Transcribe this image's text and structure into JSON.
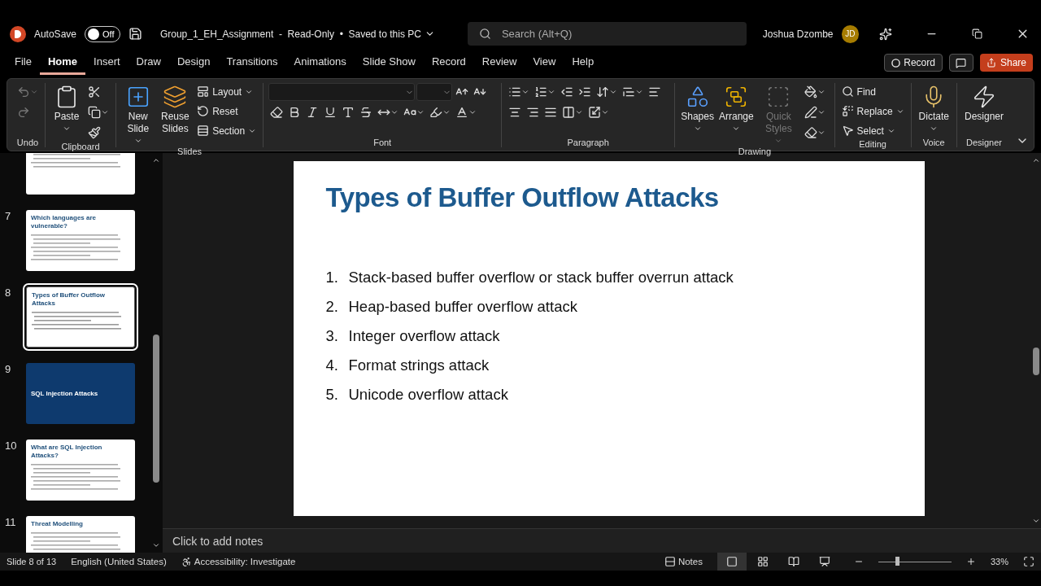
{
  "title_bar": {
    "autosave_label": "AutoSave",
    "autosave_on": false,
    "autosave_state": "Off",
    "document_title": "Group_1_EH_Assignment  -  Read-Only  •  Saved to this PC",
    "search_placeholder": "Search (Alt+Q)",
    "user_name": "Joshua Dzombe",
    "avatar_initials": "JD"
  },
  "menu_tabs": [
    {
      "label": "File",
      "selected": false
    },
    {
      "label": "Home",
      "selected": true
    },
    {
      "label": "Insert",
      "selected": false
    },
    {
      "label": "Draw",
      "selected": false
    },
    {
      "label": "Design",
      "selected": false
    },
    {
      "label": "Transitions",
      "selected": false
    },
    {
      "label": "Animations",
      "selected": false
    },
    {
      "label": "Slide Show",
      "selected": false
    },
    {
      "label": "Record",
      "selected": false
    },
    {
      "label": "Review",
      "selected": false
    },
    {
      "label": "View",
      "selected": false
    },
    {
      "label": "Help",
      "selected": false
    }
  ],
  "header_buttons": {
    "record": "Record",
    "share": "Share"
  },
  "ribbon_groups": [
    {
      "label": "Undo",
      "buttons": [
        {
          "kind": "icon",
          "disabled": true,
          "dropdown": true
        },
        {
          "kind": "icon",
          "disabled": true,
          "dropdown": false
        }
      ]
    },
    {
      "label": "Clipboard",
      "buttons": [
        {
          "kind": "large",
          "label": "Paste",
          "dropdown": true,
          "disabled": false
        },
        {
          "kind": "icon",
          "disabled": false,
          "dropdown": false
        },
        {
          "kind": "icon",
          "disabled": false,
          "dropdown": true
        },
        {
          "kind": "icon",
          "disabled": false,
          "dropdown": false
        }
      ]
    },
    {
      "label": "Slides",
      "buttons": [
        {
          "kind": "large",
          "label": "New Slide",
          "dropdown": true,
          "disabled": false
        },
        {
          "kind": "large",
          "label": "Reuse Slides",
          "dropdown": false,
          "disabled": false
        },
        {
          "kind": "small",
          "label": "Layout",
          "dropdown": true,
          "disabled": false
        },
        {
          "kind": "small",
          "label": "Reset",
          "dropdown": false,
          "disabled": false
        },
        {
          "kind": "small",
          "label": "Section",
          "dropdown": true,
          "disabled": false
        }
      ]
    },
    {
      "label": "Font",
      "buttons": [
        {
          "kind": "field"
        },
        {
          "kind": "field"
        },
        {
          "kind": "icon",
          "disabled": false,
          "dropdown": false
        },
        {
          "kind": "icon",
          "disabled": false,
          "dropdown": false
        },
        {
          "kind": "icon",
          "disabled": false,
          "dropdown": false
        },
        {
          "kind": "icon",
          "disabled": false,
          "dropdown": false
        },
        {
          "kind": "icon",
          "disabled": false,
          "dropdown": false
        },
        {
          "kind": "icon",
          "disabled": false,
          "dropdown": false
        },
        {
          "kind": "icon",
          "disabled": false,
          "dropdown": false
        },
        {
          "kind": "icon",
          "disabled": false,
          "dropdown": false
        },
        {
          "kind": "icon",
          "disabled": false,
          "dropdown": true
        },
        {
          "kind": "icon",
          "disabled": false,
          "dropdown": true
        },
        {
          "kind": "icon",
          "disabled": false,
          "dropdown": true
        },
        {
          "kind": "icon",
          "disabled": false,
          "dropdown": true
        }
      ]
    },
    {
      "label": "Paragraph",
      "buttons": [
        {
          "kind": "icon",
          "disabled": false,
          "dropdown": true
        },
        {
          "kind": "icon",
          "disabled": false,
          "dropdown": true
        },
        {
          "kind": "icon",
          "disabled": false,
          "dropdown": false
        },
        {
          "kind": "icon",
          "disabled": false,
          "dropdown": false
        },
        {
          "kind": "icon",
          "disabled": false,
          "dropdown": true
        },
        {
          "kind": "icon",
          "disabled": false,
          "dropdown": true
        },
        {
          "kind": "icon",
          "disabled": false,
          "dropdown": false
        },
        {
          "kind": "icon",
          "disabled": false,
          "dropdown": false
        },
        {
          "kind": "icon",
          "disabled": false,
          "dropdown": false
        },
        {
          "kind": "icon",
          "disabled": false,
          "dropdown": false
        },
        {
          "kind": "icon",
          "disabled": false,
          "dropdown": true
        },
        {
          "kind": "icon",
          "disabled": false,
          "dropdown": true
        }
      ]
    },
    {
      "label": "Drawing",
      "buttons": [
        {
          "kind": "large",
          "label": "Shapes",
          "dropdown": true,
          "disabled": false
        },
        {
          "kind": "large",
          "label": "Arrange",
          "dropdown": true,
          "disabled": false
        },
        {
          "kind": "large",
          "label": "Quick Styles",
          "dropdown": true,
          "disabled": true
        },
        {
          "kind": "icon",
          "disabled": false,
          "dropdown": true
        },
        {
          "kind": "icon",
          "disabled": false,
          "dropdown": true
        },
        {
          "kind": "icon",
          "disabled": false,
          "dropdown": true
        }
      ]
    },
    {
      "label": "Editing",
      "buttons": [
        {
          "kind": "small",
          "label": "Find",
          "dropdown": false,
          "disabled": false
        },
        {
          "kind": "small",
          "label": "Replace",
          "dropdown": true,
          "disabled": false
        },
        {
          "kind": "small",
          "label": "Select",
          "dropdown": true,
          "disabled": false
        }
      ]
    },
    {
      "label": "Voice",
      "buttons": [
        {
          "kind": "large",
          "label": "Dictate",
          "dropdown": true,
          "disabled": false
        }
      ]
    },
    {
      "label": "Designer",
      "buttons": [
        {
          "kind": "large",
          "label": "Designer",
          "dropdown": false,
          "disabled": false
        }
      ]
    }
  ],
  "thumbnails": [
    {
      "kind": "content",
      "selected": false
    },
    {
      "kind": "content",
      "number": "7",
      "title": "Which languages are vulnerable?",
      "selected": false
    },
    {
      "kind": "list",
      "number": "8",
      "title": "Types of Buffer Outflow Attacks",
      "selected": true
    },
    {
      "kind": "section",
      "number": "9",
      "title": "SQL Injection Attacks",
      "selected": false
    },
    {
      "kind": "content",
      "number": "10",
      "title": "What are SQL Injection Attacks?",
      "selected": false
    },
    {
      "kind": "content",
      "number": "11",
      "title": "Threat Modelling",
      "selected": false
    }
  ],
  "slide": {
    "title": "Types of Buffer Outflow Attacks",
    "items": [
      {
        "number": "1.",
        "text": "Stack-based buffer overflow or stack buffer overrun attack"
      },
      {
        "number": "2.",
        "text": "Heap-based buffer overflow attack"
      },
      {
        "number": "3.",
        "text": "Integer overflow attack"
      },
      {
        "number": "4.",
        "text": "Format strings attack"
      },
      {
        "number": "5.",
        "text": "Unicode overflow attack"
      }
    ]
  },
  "notes_placeholder": "Click to add notes",
  "status_bar": {
    "slide_info": "Slide 8 of 13",
    "language": "English (United States)",
    "accessibility": "Accessibility: Investigate",
    "notes": "Notes",
    "views": [
      {
        "selected": true
      },
      {
        "selected": false
      },
      {
        "selected": false
      },
      {
        "selected": false
      }
    ],
    "zoom": {
      "level": 0.26,
      "text": "33%"
    }
  }
}
